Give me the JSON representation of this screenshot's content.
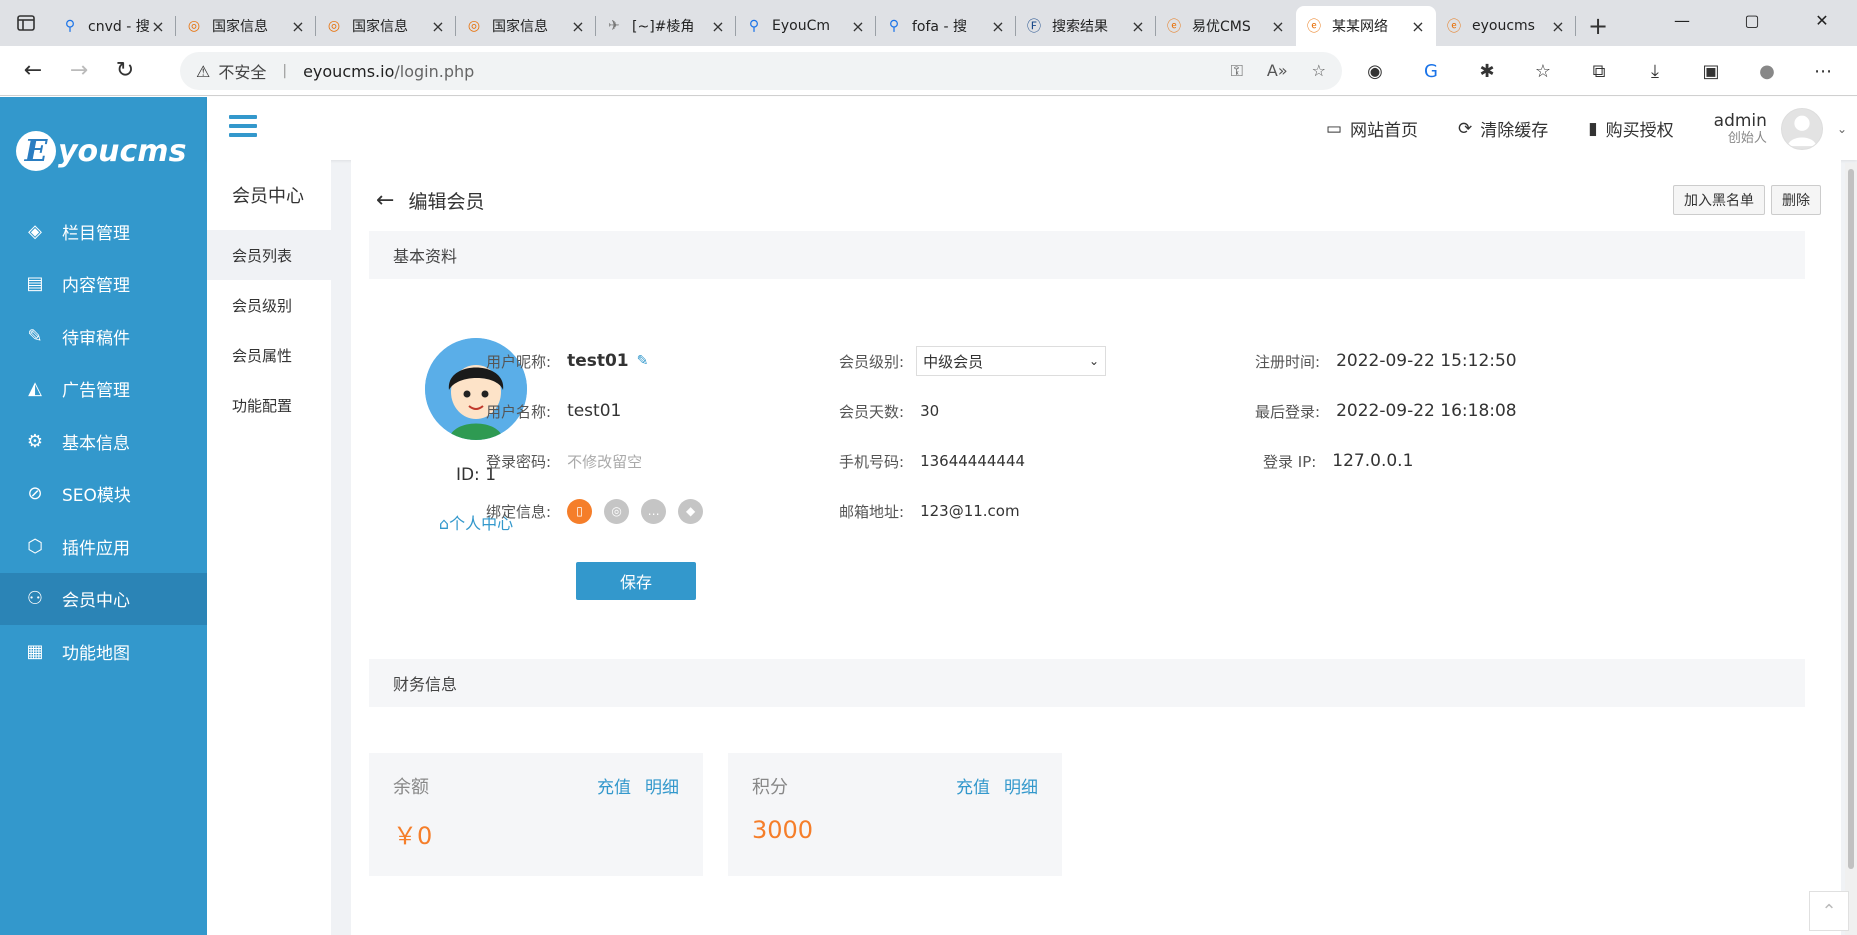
{
  "browser": {
    "tabs": [
      {
        "title": "cnvd - 搜",
        "icon": "search-icon"
      },
      {
        "title": "国家信息",
        "icon": "globe-icon"
      },
      {
        "title": "国家信息",
        "icon": "globe-icon"
      },
      {
        "title": "国家信息",
        "icon": "globe-icon"
      },
      {
        "title": "[~]#棱角",
        "icon": "bird-icon"
      },
      {
        "title": "EyouCm",
        "icon": "search-icon"
      },
      {
        "title": "fofa - 搜",
        "icon": "search-icon"
      },
      {
        "title": "搜索结果",
        "icon": "f-icon"
      },
      {
        "title": "易优CMS",
        "icon": "e-icon"
      },
      {
        "title": "某某网络",
        "icon": "e-icon"
      },
      {
        "title": "eyoucms",
        "icon": "e-icon"
      }
    ],
    "active_tab": 9,
    "address": {
      "security": "不安全",
      "host": "eyoucms.io",
      "path": "/login.php"
    }
  },
  "sidebar": {
    "logo_text": "youcms",
    "logo_letter": "E",
    "items": [
      {
        "label": "栏目管理",
        "icon": "layers-icon"
      },
      {
        "label": "内容管理",
        "icon": "document-icon"
      },
      {
        "label": "待审稿件",
        "icon": "edit-doc-icon"
      },
      {
        "label": "广告管理",
        "icon": "ad-icon"
      },
      {
        "label": "基本信息",
        "icon": "gear-icon"
      },
      {
        "label": "SEO模块",
        "icon": "seo-icon"
      },
      {
        "label": "插件应用",
        "icon": "plugin-icon"
      },
      {
        "label": "会员中心",
        "icon": "user-icon"
      },
      {
        "label": "功能地图",
        "icon": "grid-icon"
      }
    ],
    "active_index": 7
  },
  "topbar": {
    "site_home": "网站首页",
    "clear_cache": "清除缓存",
    "buy_license": "购买授权",
    "user": "admin",
    "role": "创始人"
  },
  "subnav": {
    "title": "会员中心",
    "items": [
      "会员列表",
      "会员级别",
      "会员属性",
      "功能配置"
    ],
    "active_index": 0
  },
  "page": {
    "title": "编辑会员",
    "blacklist_btn": "加入黑名单",
    "delete_btn": "删除",
    "basic_section": "基本资料",
    "finance_section": "财务信息",
    "id_label": "ID:",
    "id_value": "1",
    "personal_center": "个人中心",
    "save_btn": "保存"
  },
  "profile": {
    "nickname_label": "用户昵称:",
    "nickname": "test01",
    "username_label": "用户名称:",
    "username": "test01",
    "password_label": "登录密码:",
    "password_placeholder": "不修改留空",
    "bind_label": "绑定信息:",
    "level_label": "会员级别:",
    "level": "中级会员",
    "days_label": "会员天数:",
    "days": "30",
    "phone_label": "手机号码:",
    "phone": "13644444444",
    "email_label": "邮箱地址:",
    "email": "123@11.com",
    "reg_time_label": "注册时间:",
    "reg_time": "2022-09-22 15:12:50",
    "last_login_label": "最后登录:",
    "last_login": "2022-09-22 16:18:08",
    "login_ip_label": "登录 IP:",
    "login_ip": "127.0.0.1"
  },
  "finance": {
    "balance_label": "余额",
    "balance": "￥0",
    "points_label": "积分",
    "points": "3000",
    "recharge": "充值",
    "detail": "明细"
  },
  "colors": {
    "primary": "#3398cc",
    "primary_dark": "#2b84b6",
    "accent_orange": "#f57e2a"
  }
}
